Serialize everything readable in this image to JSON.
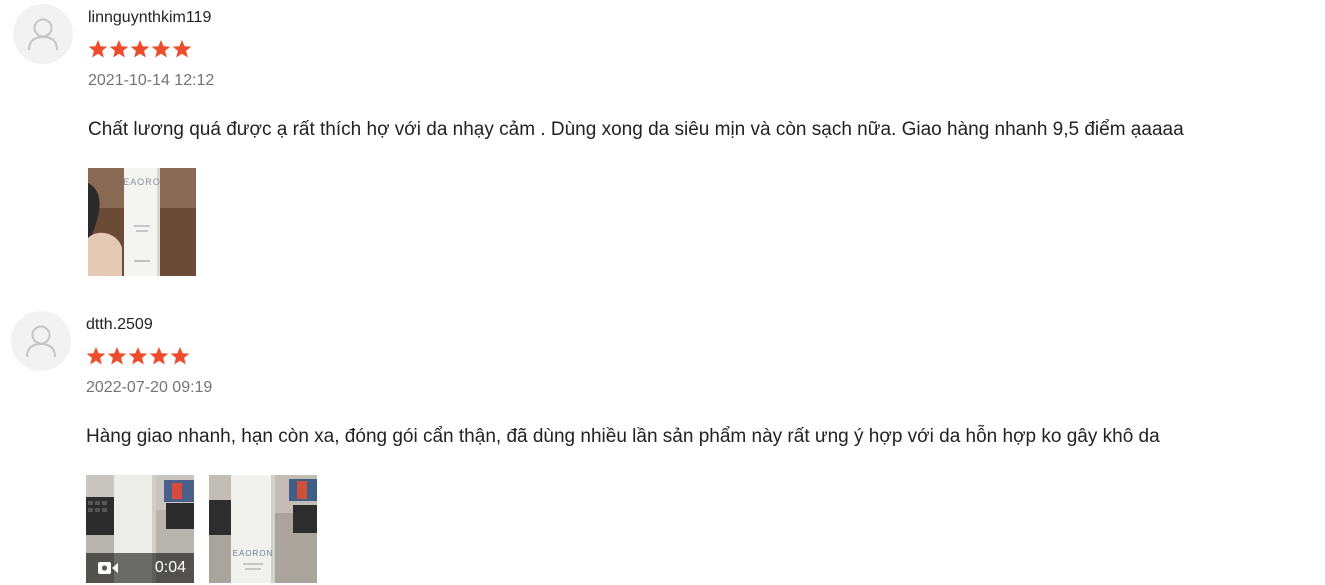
{
  "theme": {
    "star_color": "#ee4d2d",
    "text_color": "#222222",
    "muted_color": "#757575",
    "avatar_bg": "#f2f2f2"
  },
  "reviews": [
    {
      "username": "linnguynthkim119",
      "rating": 5,
      "timestamp": "2021-10-14 12:12",
      "comment": "Chất lương quá được ạ rất thích hợ với da nhạy cảm . Dùng xong da siêu mịn và còn sạch nữa. Giao hàng nhanh 9,5 điểm ạaaaa",
      "media": [
        {
          "type": "image",
          "icon": "product-photo-icon",
          "label": "EAORO"
        }
      ]
    },
    {
      "username": "dtth.2509",
      "rating": 5,
      "timestamp": "2022-07-20 09:19",
      "comment": "Hàng giao nhanh, hạn còn xa, đóng gói cẩn thận, đã dùng nhiều lần sản phẩm này rất ưng ý hợp với da hỗn hợp ko gây khô da",
      "media": [
        {
          "type": "video",
          "icon": "video-camera-icon",
          "duration": "0:04"
        },
        {
          "type": "image",
          "icon": "product-photo-icon",
          "label": "EAORON"
        }
      ]
    }
  ]
}
